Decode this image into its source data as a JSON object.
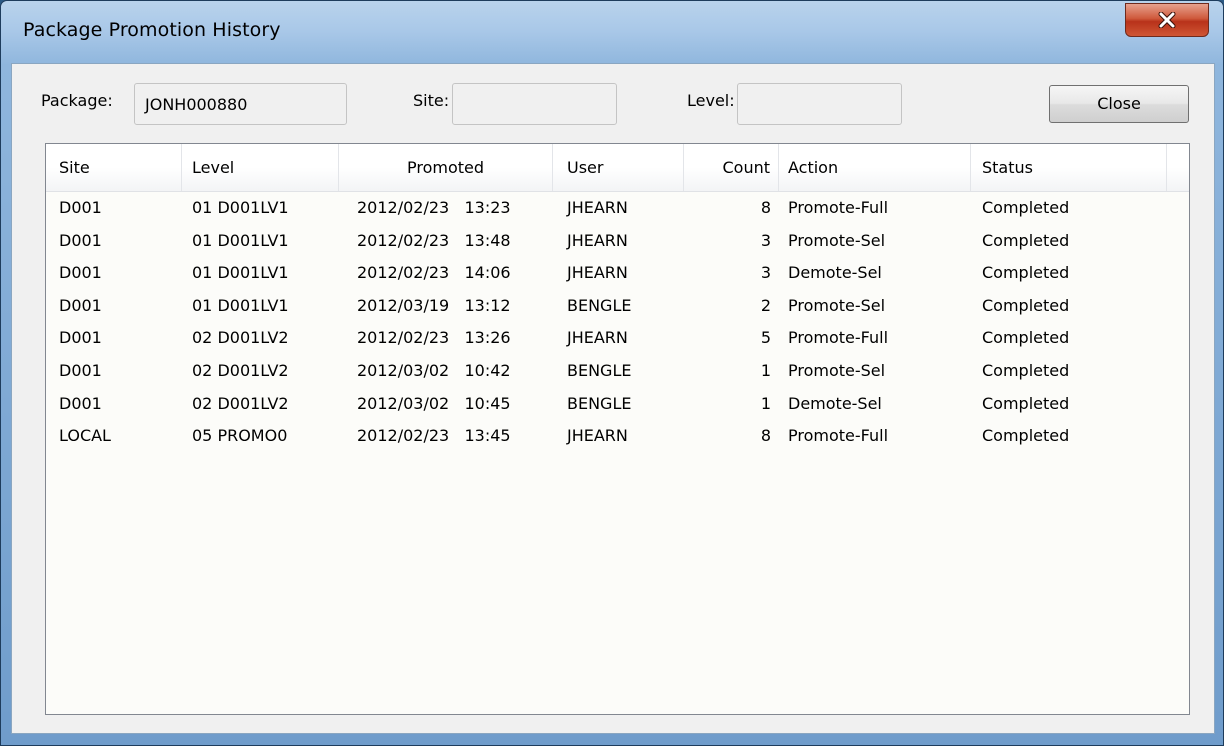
{
  "window": {
    "title": "Package Promotion History",
    "close_icon": "close-x-icon"
  },
  "form": {
    "package_label": "Package:",
    "package_value": "JONH000880",
    "site_label": "Site:",
    "site_value": "",
    "level_label": "Level:",
    "level_value": "",
    "close_button": "Close"
  },
  "table": {
    "columns": [
      "Site",
      "Level",
      "Promoted",
      "User",
      "Count",
      "Action",
      "Status"
    ],
    "rows": [
      {
        "site": "D001",
        "level": "01 D001LV1",
        "promoted": "2012/02/23   13:23",
        "user": "JHEARN",
        "count": "8",
        "action": "Promote-Full",
        "status": "Completed"
      },
      {
        "site": "D001",
        "level": "01 D001LV1",
        "promoted": "2012/02/23   13:48",
        "user": "JHEARN",
        "count": "3",
        "action": "Promote-Sel",
        "status": "Completed"
      },
      {
        "site": "D001",
        "level": "01 D001LV1",
        "promoted": "2012/02/23   14:06",
        "user": "JHEARN",
        "count": "3",
        "action": "Demote-Sel",
        "status": "Completed"
      },
      {
        "site": "D001",
        "level": "01 D001LV1",
        "promoted": "2012/03/19   13:12",
        "user": "BENGLE",
        "count": "2",
        "action": "Promote-Sel",
        "status": "Completed"
      },
      {
        "site": "D001",
        "level": "02 D001LV2",
        "promoted": "2012/02/23   13:26",
        "user": "JHEARN",
        "count": "5",
        "action": "Promote-Full",
        "status": "Completed"
      },
      {
        "site": "D001",
        "level": "02 D001LV2",
        "promoted": "2012/03/02   10:42",
        "user": "BENGLE",
        "count": "1",
        "action": "Promote-Sel",
        "status": "Completed"
      },
      {
        "site": "D001",
        "level": "02 D001LV2",
        "promoted": "2012/03/02   10:45",
        "user": "BENGLE",
        "count": "1",
        "action": "Demote-Sel",
        "status": "Completed"
      },
      {
        "site": "LOCAL",
        "level": "05 PROMO0",
        "promoted": "2012/02/23   13:45",
        "user": "JHEARN",
        "count": "8",
        "action": "Promote-Full",
        "status": "Completed"
      }
    ]
  }
}
